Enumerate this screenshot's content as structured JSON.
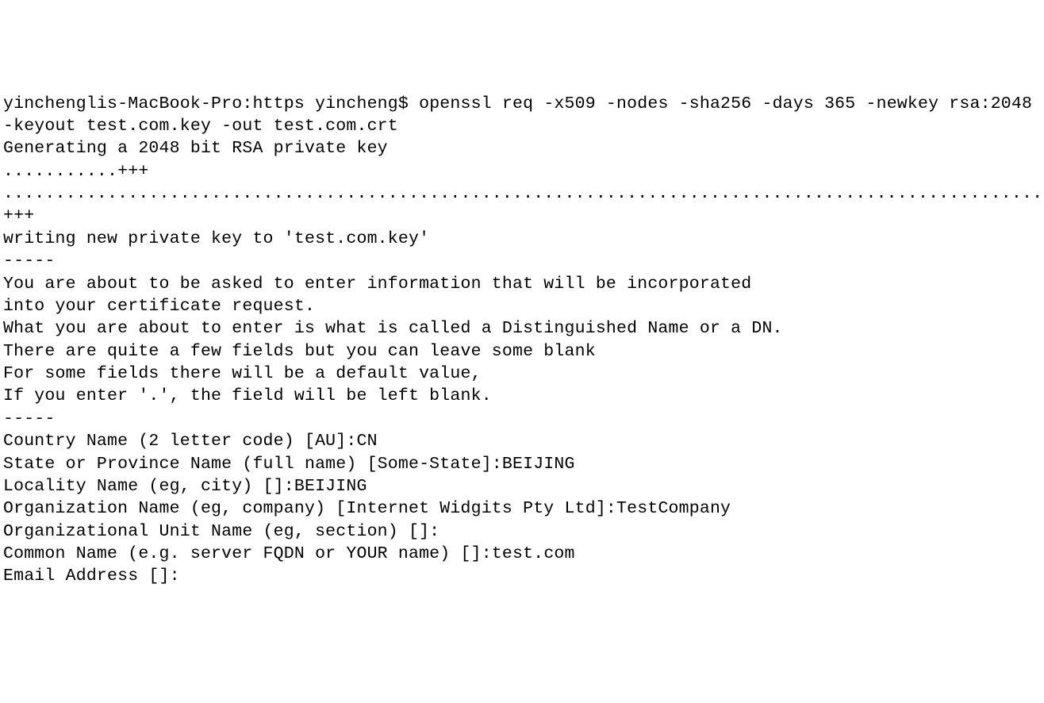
{
  "terminal": {
    "prompt": "yinchenglis-MacBook-Pro:https yincheng$ ",
    "command": "openssl req -x509 -nodes -sha256 -days 365 -newkey rsa:2048 -keyout test.com.key -out test.com.crt",
    "gen_line": "Generating a 2048 bit RSA private key",
    "dots1": "...........+++",
    "dots2": ".....................................................................................................................................+++",
    "writing": "writing new private key to 'test.com.key'",
    "sep": "-----",
    "info1": "You are about to be asked to enter information that will be incorporated",
    "info2": "into your certificate request.",
    "info3": "What you are about to enter is what is called a Distinguished Name or a DN.",
    "info4": "There are quite a few fields but you can leave some blank",
    "info5": "For some fields there will be a default value,",
    "info6": "If you enter '.', the field will be left blank.",
    "prompts": {
      "country_label": "Country Name (2 letter code) [AU]:",
      "country_value": "CN",
      "state_label": "State or Province Name (full name) [Some-State]:",
      "state_value": "BEIJING",
      "locality_label": "Locality Name (eg, city) []:",
      "locality_value": "BEIJING",
      "org_label": "Organization Name (eg, company) [Internet Widgits Pty Ltd]:",
      "org_value": "TestCompany",
      "ou_label": "Organizational Unit Name (eg, section) []:",
      "ou_value": "",
      "cn_label": "Common Name (e.g. server FQDN or YOUR name) []:",
      "cn_value": "test.com",
      "email_label": "Email Address []:",
      "email_value": ""
    }
  }
}
